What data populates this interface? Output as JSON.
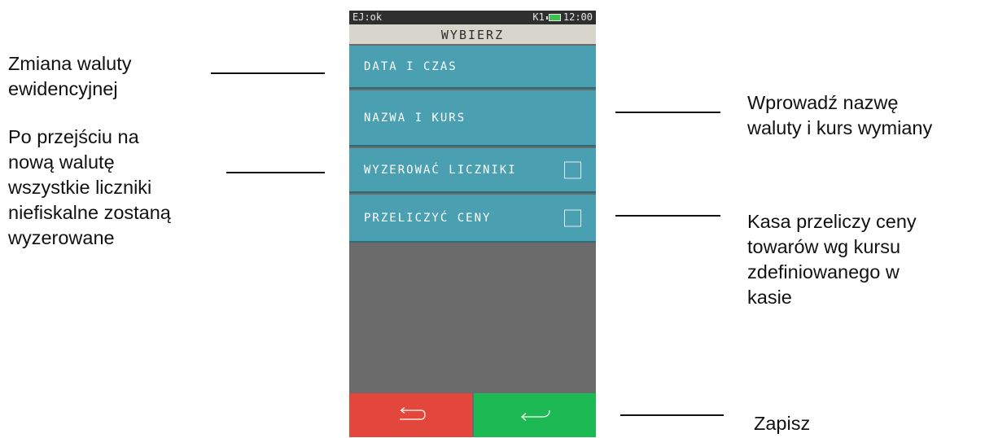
{
  "device": {
    "status_left": "EJ:ok",
    "status_k": "K1",
    "time": "12:00",
    "title": "WYBIERZ",
    "menu": [
      {
        "label": "DATA I CZAS",
        "checkbox": false
      },
      {
        "label": "NAZWA I KURS",
        "checkbox": false
      },
      {
        "label": "WYZEROWAĆ LICZNIKI",
        "checkbox": true,
        "checked": false
      },
      {
        "label": "PRZELICZYĆ CENY",
        "checkbox": true,
        "checked": false
      }
    ],
    "buttons": {
      "back_icon": "return-arrow-icon",
      "save_icon": "enter-arrow-icon"
    },
    "colors": {
      "menu": "#4a9fb1",
      "back": "#e3463a",
      "save": "#1db954",
      "empty_area": "#6b6b6b"
    }
  },
  "annotations": {
    "a1": [
      "Zmiana waluty",
      "ewidencyjnej"
    ],
    "a2": [
      "Po przejściu na",
      "nową walutę",
      "wszystkie liczniki",
      "niefiskalne zostaną",
      "wyzerowane"
    ],
    "a3": [
      "Wprowadź nazwę",
      "waluty i kurs wymiany"
    ],
    "a4": [
      "Kasa przeliczy ceny",
      "towarów wg kursu",
      "zdefiniowanego w",
      "kasie"
    ],
    "a5": [
      "Zapisz"
    ]
  }
}
